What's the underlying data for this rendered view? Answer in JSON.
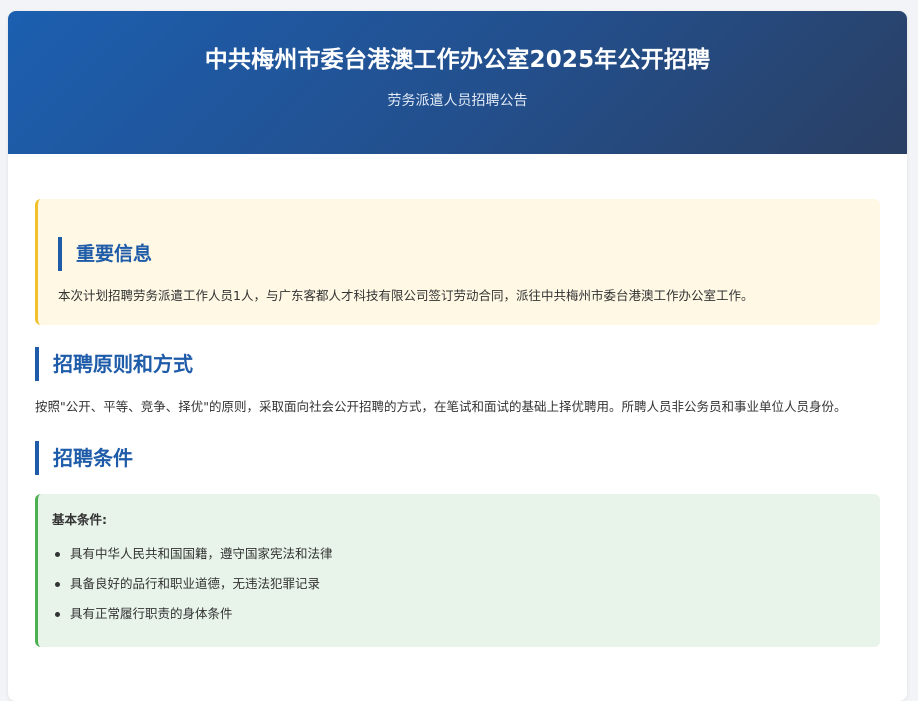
{
  "header": {
    "title": "中共梅州市委台港澳工作办公室2025年公开招聘",
    "subtitle": "劳务派遣人员招聘公告"
  },
  "notice": {
    "title": "重要信息",
    "text": "本次计划招聘劳务派遣工作人员1人，与广东客都人才科技有限公司签订劳动合同，派往中共梅州市委台港澳工作办公室工作。"
  },
  "principles": {
    "title": "招聘原则和方式",
    "text": "按照\"公开、平等、竞争、择优\"的原则，采取面向社会公开招聘的方式，在笔试和面试的基础上择优聘用。所聘人员非公务员和事业单位人员身份。"
  },
  "conditions": {
    "title": "招聘条件",
    "heading": "基本条件:",
    "items": [
      "具有中华人民共和国国籍，遵守国家宪法和法律",
      "具备良好的品行和职业道德，无违法犯罪记录",
      "具有正常履行职责的身体条件"
    ]
  },
  "colors": {
    "header_gradient_start": "#1c5fb0",
    "header_gradient_end": "#2a3f63",
    "accent_blue": "#1e5ba8",
    "notice_bg": "#fef8e4",
    "notice_border": "#f0c12a",
    "conditions_bg": "#e8f4ea",
    "conditions_border": "#4caf50"
  }
}
